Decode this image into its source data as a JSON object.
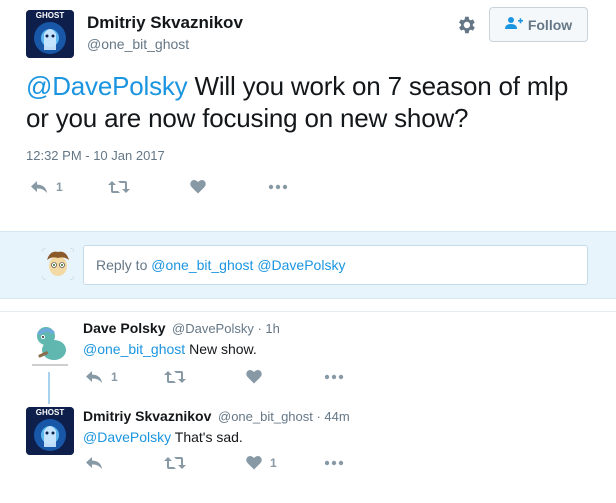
{
  "tweet": {
    "author_name": "Dmitriy Skvaznikov",
    "author_handle": "@one_bit_ghost",
    "avatar_text": "GHOST",
    "follow_label": "Follow",
    "mention": "@DavePolsky",
    "text": " Will you work on 7 season of mlp or you are now focusing on new show?",
    "timestamp": "12:32 PM - 10 Jan 2017",
    "actions": {
      "reply_count": "1",
      "retweet_count": "",
      "like_count": ""
    }
  },
  "reply_box": {
    "placeholder": "Reply to ",
    "mentions": "@one_bit_ghost @DavePolsky"
  },
  "replies": [
    {
      "name": "Dave Polsky",
      "handle_time": "@DavePolsky · 1h",
      "mention": "@one_bit_ghost",
      "text": " New show.",
      "reply_count": "1",
      "like_count": ""
    },
    {
      "name": "Dmitriy Skvaznikov",
      "handle_time": "@one_bit_ghost · 44m",
      "mention": "@DavePolsky",
      "text": " That's sad.",
      "reply_count": "",
      "like_count": "1",
      "avatar_text": "GHOST"
    }
  ],
  "colors": {
    "link": "#1b95e0",
    "icon": "#8899a6",
    "reply_bg": "#e8f4fb"
  }
}
